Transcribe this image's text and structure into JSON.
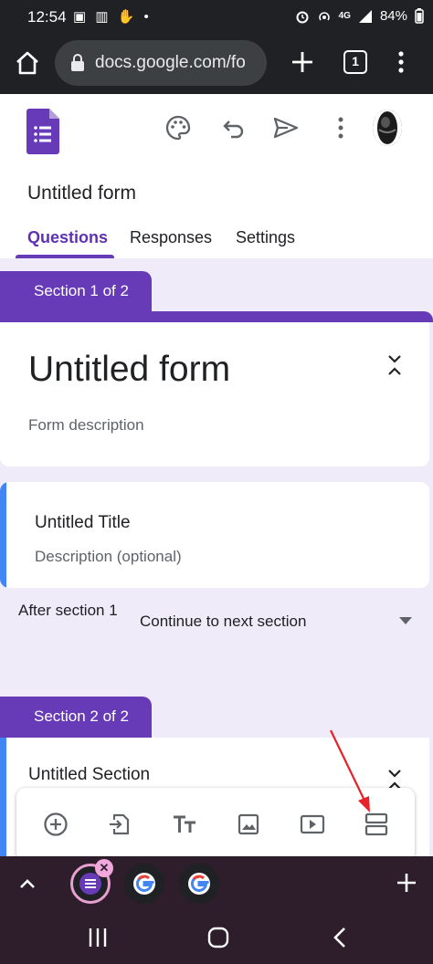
{
  "statusbar": {
    "time": "12:54",
    "left_icons": "▣ ▥ ✋ •",
    "network": "4G",
    "battery": "84%"
  },
  "browser": {
    "url": "docs.google.com/fo",
    "tab_count": "1"
  },
  "header": {
    "form_name": "Untitled form",
    "tabs": [
      {
        "label": "Questions",
        "active": true
      },
      {
        "label": "Responses",
        "active": false
      },
      {
        "label": "Settings",
        "active": false
      }
    ]
  },
  "section1": {
    "label": "Section 1 of 2",
    "title": "Untitled form",
    "description": "Form description"
  },
  "title_block": {
    "title": "Untitled Title",
    "description": "Description (optional)"
  },
  "after_section": {
    "label": "After section 1",
    "value": "Continue to next section"
  },
  "section2": {
    "label": "Section 2 of 2",
    "title": "Untitled Section"
  },
  "toolbar": {
    "tools": [
      "add-question",
      "import-questions",
      "add-title",
      "add-image",
      "add-video",
      "add-section"
    ]
  },
  "colors": {
    "accent": "#673ab7",
    "canvas": "#f0ebf8",
    "blue_bar": "#4285f4",
    "annotation": "#e8202a"
  }
}
